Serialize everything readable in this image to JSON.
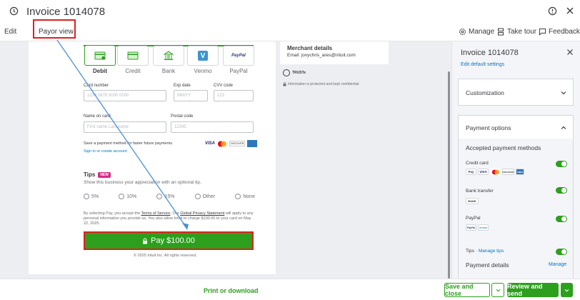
{
  "window": {
    "title": "Invoice 1014078"
  },
  "tabs": {
    "edit": "Edit",
    "payor_view": "Payor view"
  },
  "toolbar": {
    "manage": "Manage",
    "take_tour": "Take tour",
    "feedback": "Feedback"
  },
  "payment_methods": [
    {
      "label": "Debit",
      "selected": true,
      "icon": "debit-card-icon"
    },
    {
      "label": "Credit",
      "selected": false,
      "icon": "credit-card-icon"
    },
    {
      "label": "Bank",
      "selected": false,
      "icon": "bank-icon"
    },
    {
      "label": "Venmo",
      "selected": false,
      "icon": "venmo-icon"
    },
    {
      "label": "PayPal",
      "selected": false,
      "icon": "paypal-icon"
    }
  ],
  "logos": {
    "venmo": "V",
    "paypal": "PayPal"
  },
  "form": {
    "card_number_label": "Card number",
    "card_number_placeholder": "1234 5678 9000 0000",
    "exp_label": "Exp date",
    "exp_placeholder": "MM/YY",
    "cvv_label": "CVV code",
    "cvv_placeholder": "123",
    "name_label": "Name on card",
    "name_placeholder": "First name Last name",
    "postal_label": "Postal code",
    "postal_placeholder": "12345",
    "save_text": "Save a payment method for faster future payments.",
    "sign_in": "Sign in or create account"
  },
  "card_brands": {
    "visa": "VISA",
    "discover": "DISCOVER"
  },
  "tips": {
    "title": "Tips",
    "badge": "NEW",
    "subtitle": "Show this business your appreciation with an optional tip.",
    "options": [
      "5%",
      "10%",
      "15%",
      "Other",
      "None"
    ]
  },
  "legal": {
    "pre": "By selecting Pay, you accept the ",
    "terms": "Terms of Service",
    "mid": ". Our ",
    "privacy": "Global Privacy Statement",
    "post": " will apply to any personal information you provide us. You also allow Intuit to charge $100.00 to your card on May 22, 2025."
  },
  "pay_button": "Pay $100.00",
  "copyright": "© 2025 Intuit Inc. All rights reserved.",
  "merchant": {
    "title": "Merchant details",
    "email": "Email: jovychris_ares@intuit.com",
    "truste": "TRUSTe",
    "secure": "Information is protected and kept confidential"
  },
  "panel": {
    "title": "Invoice 1014078",
    "edit_defaults": "Edit default settings",
    "customization": "Customization",
    "payment_options": "Payment options",
    "accepted": "Accepted payment methods",
    "credit_card": "Credit card",
    "bank_transfer": "Bank transfer",
    "bank_logo": "BANK",
    "paypal": "PayPal",
    "tips_prefix": "Tips · ",
    "manage_tips": "Manage tips",
    "payment_details": "Payment details",
    "manage": "Manage",
    "logos": {
      "applepay": "Pay",
      "visa": "VISA",
      "discover": "DISCOVER",
      "amex": "AMEX",
      "paypal": "PayPal",
      "venmo": "venmo"
    }
  },
  "footer": {
    "print": "Print or download",
    "save_close": "Save and close",
    "review_send": "Review and send"
  },
  "colors": {
    "green": "#2ca01c",
    "red_highlight": "#e0201f",
    "blue_link": "#0077c5",
    "arrow": "#4a90d9"
  }
}
